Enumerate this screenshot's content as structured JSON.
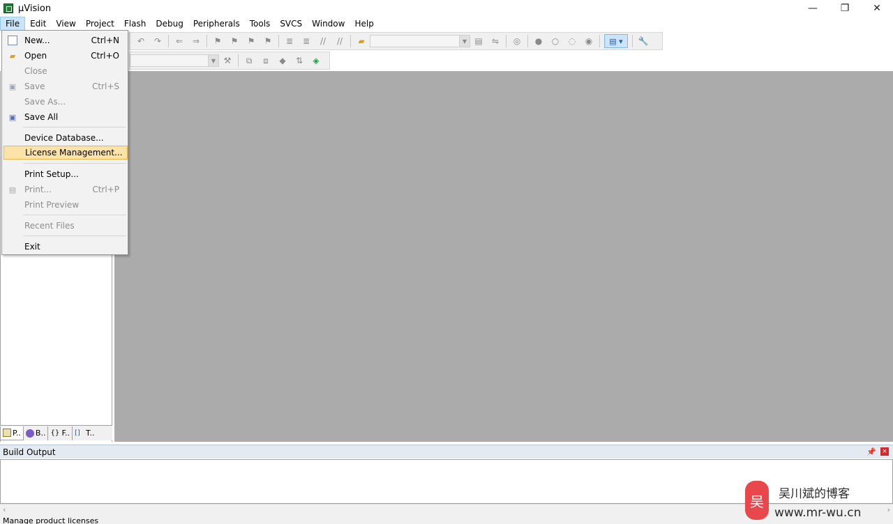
{
  "window": {
    "title": "µVision",
    "minimize": "—",
    "maximize": "❐",
    "close": "✕"
  },
  "menubar": {
    "items": [
      "File",
      "Edit",
      "View",
      "Project",
      "Flash",
      "Debug",
      "Peripherals",
      "Tools",
      "SVCS",
      "Window",
      "Help"
    ]
  },
  "file_menu": {
    "items": [
      {
        "label": "New...",
        "shortcut": "Ctrl+N",
        "icon": "new-file-icon",
        "enabled": true
      },
      {
        "label": "Open",
        "shortcut": "Ctrl+O",
        "icon": "open-folder-icon",
        "enabled": true
      },
      {
        "label": "Close",
        "shortcut": "",
        "icon": "",
        "enabled": false
      },
      {
        "label": "Save",
        "shortcut": "Ctrl+S",
        "icon": "save-icon",
        "enabled": false
      },
      {
        "label": "Save As...",
        "shortcut": "",
        "icon": "",
        "enabled": false
      },
      {
        "label": "Save All",
        "shortcut": "",
        "icon": "save-all-icon",
        "enabled": true
      },
      {
        "label": "Device Database...",
        "shortcut": "",
        "icon": "",
        "enabled": true
      },
      {
        "label": "License Management...",
        "shortcut": "",
        "icon": "",
        "enabled": true,
        "highlighted": true
      },
      {
        "label": "Print Setup...",
        "shortcut": "",
        "icon": "",
        "enabled": true
      },
      {
        "label": "Print...",
        "shortcut": "Ctrl+P",
        "icon": "print-icon",
        "enabled": false
      },
      {
        "label": "Print Preview",
        "shortcut": "",
        "icon": "",
        "enabled": false
      },
      {
        "label": "Recent Files",
        "shortcut": "",
        "icon": "",
        "enabled": false
      },
      {
        "label": "Exit",
        "shortcut": "",
        "icon": "",
        "enabled": true
      }
    ]
  },
  "panel_tabs": [
    {
      "label": "P..",
      "icon": "project-icon"
    },
    {
      "label": "B..",
      "icon": "books-icon"
    },
    {
      "label": "F..",
      "icon": "functions-icon"
    },
    {
      "label": "T..",
      "icon": "templates-icon"
    }
  ],
  "build_output": {
    "title": "Build Output",
    "pin": "📌",
    "close": "×"
  },
  "statusbar": {
    "text": "Manage product licenses"
  },
  "watermark": {
    "logo": "吴",
    "name": "吴川斌的博客",
    "url": "www.mr-wu.cn"
  }
}
